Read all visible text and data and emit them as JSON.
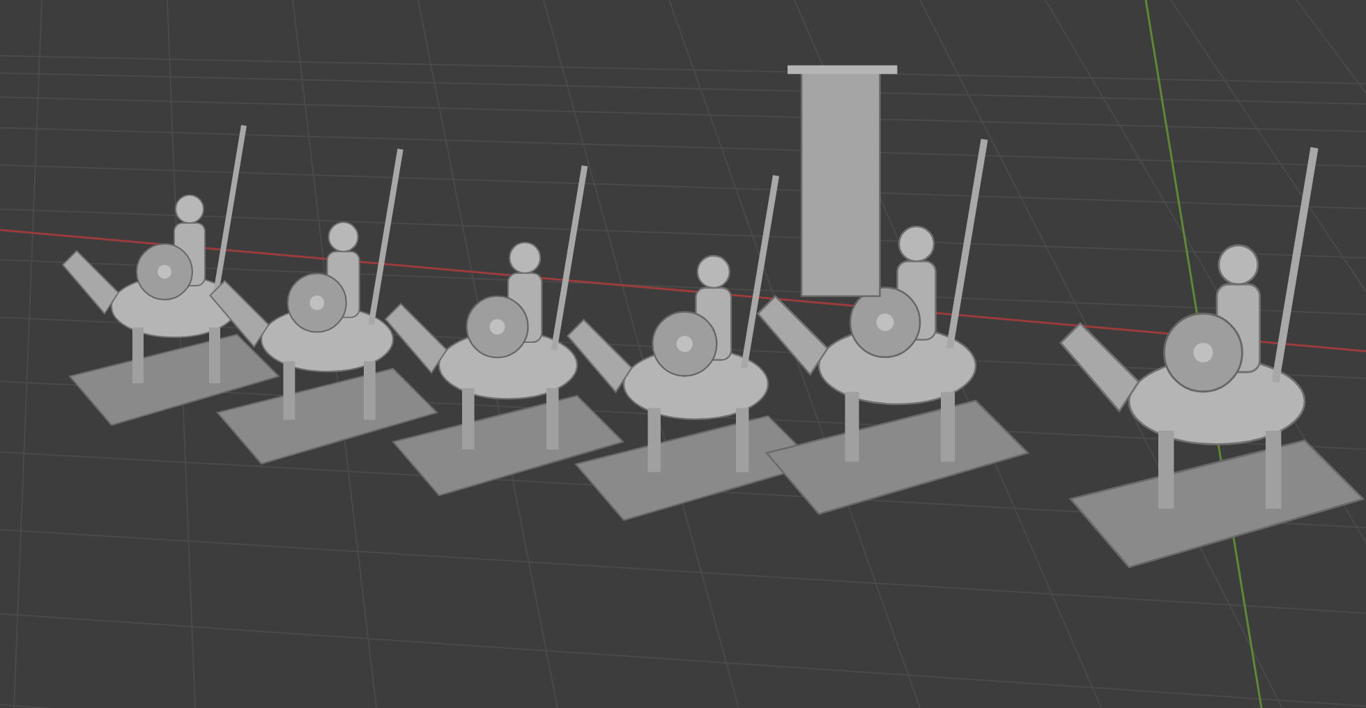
{
  "viewport": {
    "axes": [
      {
        "kind": "x",
        "color": "#9b3c3c"
      },
      {
        "kind": "y",
        "color": "#5e8a34"
      }
    ],
    "models": [
      {
        "kind": "cavalry"
      },
      {
        "kind": "cavalry"
      },
      {
        "kind": "cavalry"
      },
      {
        "kind": "cavalry"
      },
      {
        "kind": "banner"
      },
      {
        "kind": "cavalry"
      }
    ]
  }
}
